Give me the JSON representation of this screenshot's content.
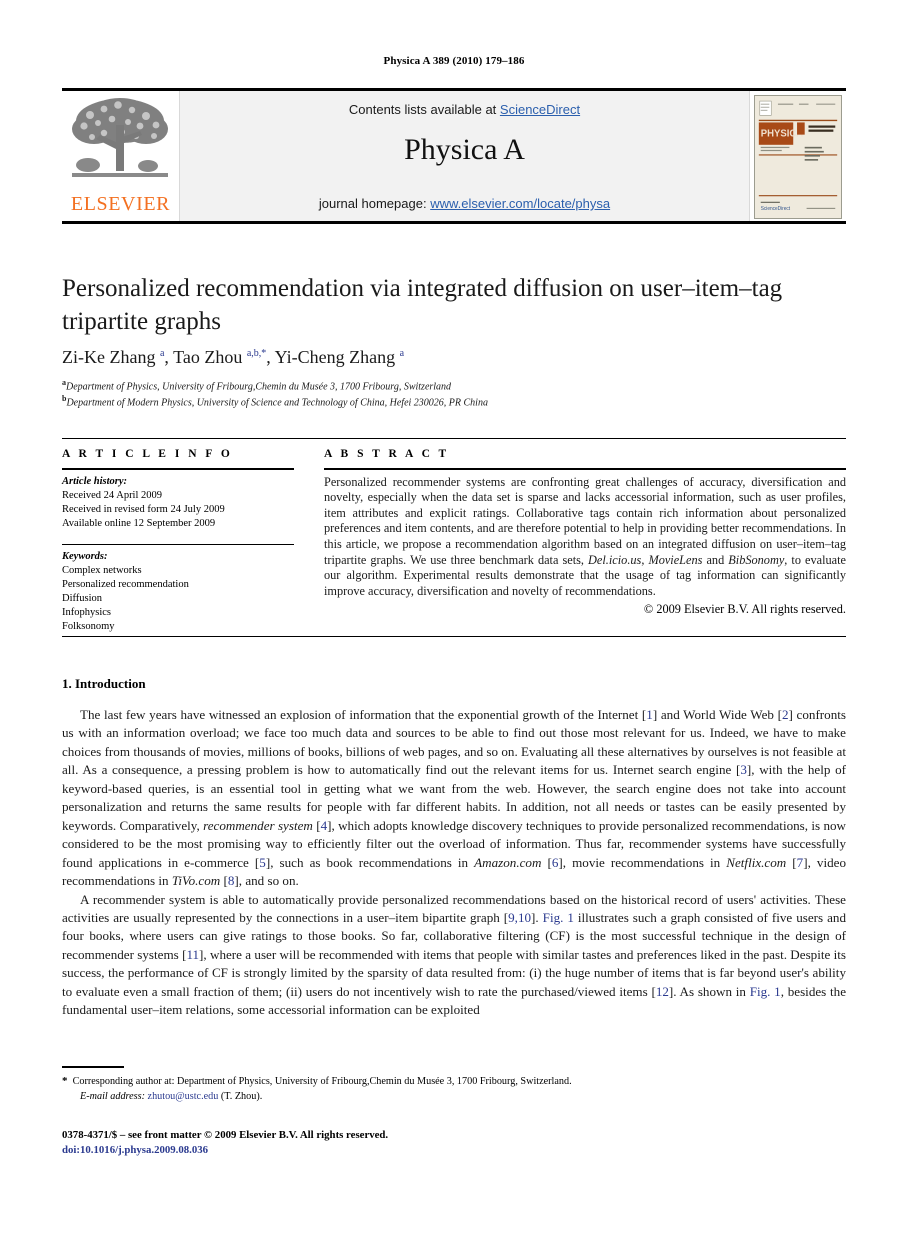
{
  "running_head": "Physica A 389 (2010) 179–186",
  "masthead": {
    "publisher": "ELSEVIER",
    "contents_prefix": "Contents lists available at ",
    "contents_link": "ScienceDirect",
    "journal_name": "Physica A",
    "homepage_prefix": "journal homepage: ",
    "homepage_url": "www.elsevier.com/locate/physa",
    "cover_title": "PHYSICA",
    "cover_subtitle_1": "STATISTICAL MECHANICS",
    "cover_subtitle_2": "AND ITS APPLICATIONS",
    "cover_badge": "ScienceDirect"
  },
  "article": {
    "title": "Personalized recommendation via integrated diffusion on user–item–tag tripartite graphs",
    "authors_html": "Zi-Ke Zhang <sup>a</sup>, Tao Zhou <sup>a,b,</sup><sup>*</sup>, Yi-Cheng Zhang <sup>a</sup>",
    "affiliation_a_marker": "a",
    "affiliation_a": "Department of Physics, University of Fribourg,Chemin du Musée 3, 1700 Fribourg, Switzerland",
    "affiliation_b_marker": "b",
    "affiliation_b": "Department of Modern Physics, University of Science and Technology of China, Hefei 230026, PR China"
  },
  "info": {
    "label": "A R T I C L E    I N F O",
    "history_head": "Article history:",
    "history": [
      "Received 24 April 2009",
      "Received in revised form 24 July 2009",
      "Available online 12 September 2009"
    ],
    "keywords_head": "Keywords:",
    "keywords": [
      "Complex networks",
      "Personalized recommendation",
      "Diffusion",
      "Infophysics",
      "Folksonomy"
    ]
  },
  "abstract": {
    "label": "A B S T R A C T",
    "text_html": "Personalized recommender systems are confronting great challenges of accuracy, diversification and novelty, especially when the data set is sparse and lacks accessorial information, such as user profiles, item attributes and explicit ratings. Collaborative tags contain rich information about personalized preferences and item contents, and are therefore potential to help in providing better recommendations. In this article, we propose a recommendation algorithm based on an integrated diffusion on user–item–tag tripartite graphs. We use three benchmark data sets, <i>Del.icio.us</i>, <i>MovieLens</i> and <i>BibSonomy</i>, to evaluate our algorithm. Experimental results demonstrate that the usage of tag information can significantly improve accuracy, diversification and novelty of recommendations.",
    "copyright": "© 2009 Elsevier B.V. All rights reserved."
  },
  "body": {
    "section_title": "1. Introduction",
    "paragraph_1_html": "The last few years have witnessed an explosion of information that the exponential growth of the Internet [<span class=\"ref\">1</span>] and World Wide Web [<span class=\"ref\">2</span>] confronts us with an information overload; we face too much data and sources to be able to find out those most relevant for us. Indeed, we have to make choices from thousands of movies, millions of books, billions of web pages, and so on. Evaluating all these alternatives by ourselves is not feasible at all. As a consequence, a pressing problem is how to automatically find out the relevant items for us. Internet search engine [<span class=\"ref\">3</span>], with the help of keyword-based queries, is an essential tool in getting what we want from the web. However, the search engine does not take into account personalization and returns the same results for people with far different habits. In addition, not all needs or tastes can be easily presented by keywords. Comparatively, <i>recommender system</i> [<span class=\"ref\">4</span>], which adopts knowledge discovery techniques to provide personalized recommendations, is now considered to be the most promising way to efficiently filter out the overload of information. Thus far, recommender systems have successfully found applications in e-commerce [<span class=\"ref\">5</span>], such as book recommendations in <i>Amazon.com</i> [<span class=\"ref\">6</span>], movie recommendations in <i>Netflix.com</i> [<span class=\"ref\">7</span>], video recommendations in <i>TiVo.com</i> [<span class=\"ref\">8</span>], and so on.",
    "paragraph_2_html": "A recommender system is able to automatically provide personalized recommendations based on the historical record of users' activities. These activities are usually represented by the connections in a user–item bipartite graph [<span class=\"ref\">9,10</span>]. <span class=\"figref\">Fig. 1</span> illustrates such a graph consisted of five users and four books, where users can give ratings to those books. So far, collaborative filtering (CF) is the most successful technique in the design of recommender systems [<span class=\"ref\">11</span>], where a user will be recommended with items that people with similar tastes and preferences liked in the past. Despite its success, the performance of CF is strongly limited by the sparsity of data resulted from: (i) the huge number of items that is far beyond user's ability to evaluate even a small fraction of them; (ii) users do not incentively wish to rate the purchased/viewed items [<span class=\"ref\">12</span>]. As shown in <span class=\"figref\">Fig. 1</span>, besides the fundamental user–item relations, some accessorial information can be exploited"
  },
  "footer": {
    "corresponding_html": "<span class=\"star\">*</span>&nbsp; Corresponding author at: Department of Physics, University of Fribourg,Chemin du Musée 3, 1700 Fribourg, Switzerland.",
    "email_html": "<i>E-mail address:</i> <span class=\"mail\">zhutou@ustc.edu</span> (T. Zhou).",
    "issn_line": "0378-4371/$ – see front matter © 2009 Elsevier B.V. All rights reserved.",
    "doi_line": "doi:10.1016/j.physa.2009.08.036"
  },
  "colors": {
    "link_blue": "#2b5fad",
    "ref_blue": "#2b3a8f",
    "elsevier_orange": "#F37021",
    "masthead_gray": "#f2f2f2"
  }
}
